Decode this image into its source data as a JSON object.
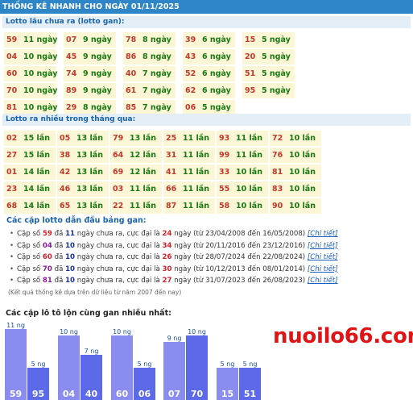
{
  "header": {
    "title": "THỐNG KÊ NHANH CHO NGÀY 01/11/2025"
  },
  "gan_section": {
    "title": "Lotto lâu chưa ra (lotto gan):",
    "columns": [
      [
        {
          "num": "59",
          "count": "11 ngày"
        },
        {
          "num": "04",
          "count": "10 ngày"
        },
        {
          "num": "60",
          "count": "10 ngày"
        },
        {
          "num": "70",
          "count": "10 ngày"
        },
        {
          "num": "81",
          "count": "10 ngày"
        }
      ],
      [
        {
          "num": "07",
          "count": "9 ngày"
        },
        {
          "num": "45",
          "count": "9 ngày"
        },
        {
          "num": "74",
          "count": "9 ngày"
        },
        {
          "num": "89",
          "count": "9 ngày"
        },
        {
          "num": "29",
          "count": "8 ngày"
        }
      ],
      [
        {
          "num": "78",
          "count": "8 ngày"
        },
        {
          "num": "86",
          "count": "8 ngày"
        },
        {
          "num": "40",
          "count": "7 ngày"
        },
        {
          "num": "61",
          "count": "7 ngày"
        },
        {
          "num": "85",
          "count": "7 ngày"
        }
      ],
      [
        {
          "num": "39",
          "count": "6 ngày"
        },
        {
          "num": "43",
          "count": "6 ngày"
        },
        {
          "num": "52",
          "count": "6 ngày"
        },
        {
          "num": "62",
          "count": "6 ngày"
        },
        {
          "num": "06",
          "count": "5 ngày"
        }
      ],
      [
        {
          "num": "15",
          "count": "5 ngày"
        },
        {
          "num": "20",
          "count": "5 ngày"
        },
        {
          "num": "51",
          "count": "5 ngày"
        },
        {
          "num": "95",
          "count": "5 ngày"
        }
      ]
    ]
  },
  "frequent_section": {
    "title": "Lotto ra nhiều trong tháng qua:",
    "columns": [
      [
        {
          "num": "02",
          "count": "15 lần"
        },
        {
          "num": "27",
          "count": "15 lần"
        },
        {
          "num": "01",
          "count": "14 lần"
        },
        {
          "num": "23",
          "count": "14 lần"
        },
        {
          "num": "68",
          "count": "14 lần"
        }
      ],
      [
        {
          "num": "05",
          "count": "13 lần"
        },
        {
          "num": "38",
          "count": "13 lần"
        },
        {
          "num": "42",
          "count": "13 lần"
        },
        {
          "num": "46",
          "count": "13 lần"
        },
        {
          "num": "65",
          "count": "13 lần"
        }
      ],
      [
        {
          "num": "79",
          "count": "13 lần"
        },
        {
          "num": "64",
          "count": "12 lần"
        },
        {
          "num": "69",
          "count": "12 lần"
        },
        {
          "num": "03",
          "count": "11 lần"
        },
        {
          "num": "22",
          "count": "11 lần"
        }
      ],
      [
        {
          "num": "25",
          "count": "11 lần"
        },
        {
          "num": "31",
          "count": "11 lần"
        },
        {
          "num": "41",
          "count": "11 lần"
        },
        {
          "num": "66",
          "count": "11 lần"
        },
        {
          "num": "87",
          "count": "11 lần"
        }
      ],
      [
        {
          "num": "93",
          "count": "11 lần"
        },
        {
          "num": "99",
          "count": "11 lần"
        },
        {
          "num": "33",
          "count": "10 lần"
        },
        {
          "num": "55",
          "count": "10 lần"
        },
        {
          "num": "58",
          "count": "10 lần"
        }
      ],
      [
        {
          "num": "72",
          "count": "10 lần"
        },
        {
          "num": "76",
          "count": "10 lần"
        },
        {
          "num": "81",
          "count": "10 lần"
        },
        {
          "num": "83",
          "count": "10 lần"
        },
        {
          "num": "90",
          "count": "10 lần"
        }
      ]
    ]
  },
  "pairs_section": {
    "title": "Các cặp lotto dẫn đầu bảng gan:",
    "items": [
      {
        "prefix": "Cặp số ",
        "pair": "59",
        "mid1": " đã ",
        "days": "11",
        "mid2": " ngày chưa ra, cực đại là ",
        "max": "24",
        "range": " ngày (từ 23/04/2008 đến 16/05/2008) ",
        "link": "[Chi tiết]",
        "pair_style": "red"
      },
      {
        "prefix": "Cặp số ",
        "pair": "04",
        "mid1": " đã ",
        "days": "10",
        "mid2": " ngày chưa ra, cực đại là ",
        "max": "34",
        "range": " ngày (từ 20/11/2016 đến 23/12/2016) ",
        "link": "[Chi tiết]",
        "pair_style": "pur"
      },
      {
        "prefix": "Cặp số ",
        "pair": "60",
        "mid1": " đã ",
        "days": "10",
        "mid2": " ngày chưa ra, cực đại là ",
        "max": "26",
        "range": " ngày (từ 28/07/2024 đến 22/08/2024) ",
        "link": "[Chi tiết]",
        "pair_style": "red"
      },
      {
        "prefix": "Cặp số ",
        "pair": "70",
        "mid1": " đã ",
        "days": "10",
        "mid2": " ngày chưa ra, cực đại là ",
        "max": "30",
        "range": " ngày (từ 10/12/2013 đến 08/01/2014) ",
        "link": "[Chi tiết]",
        "pair_style": "pur"
      },
      {
        "prefix": "Cặp số ",
        "pair": "81",
        "mid1": " đã ",
        "days": "10",
        "mid2": " ngày chưa ra, cực đại là ",
        "max": "27",
        "range": " ngày (từ 31/07/2023 đến 26/08/2023) ",
        "link": "[Chi tiết]",
        "pair_style": "pur"
      }
    ],
    "note": "(Kết quả thống kê dựa trên dữ liệu từ năm 2007 đến nay)"
  },
  "chart_section": {
    "title": "Các cặp lô tô lộn cùng gan nhiều nhất:"
  },
  "chart_data": {
    "type": "bar",
    "groups": [
      {
        "bars": [
          {
            "label": "59",
            "value": 11,
            "value_label": "11 ng"
          },
          {
            "label": "95",
            "value": 5,
            "value_label": "5 ng"
          }
        ]
      },
      {
        "bars": [
          {
            "label": "04",
            "value": 10,
            "value_label": "10 ng"
          },
          {
            "label": "40",
            "value": 7,
            "value_label": "7 ng"
          }
        ]
      },
      {
        "bars": [
          {
            "label": "60",
            "value": 10,
            "value_label": "10 ng"
          },
          {
            "label": "06",
            "value": 5,
            "value_label": "5 ng"
          }
        ]
      },
      {
        "bars": [
          {
            "label": "07",
            "value": 9,
            "value_label": "9 ng"
          },
          {
            "label": "70",
            "value": 10,
            "value_label": "10 ng"
          }
        ]
      },
      {
        "bars": [
          {
            "label": "15",
            "value": 5,
            "value_label": "5 ng"
          },
          {
            "label": "51",
            "value": 5,
            "value_label": "5 ng"
          }
        ]
      }
    ],
    "colors": {
      "first": "#8b8cf0",
      "second": "#5c69e8"
    }
  },
  "brand": {
    "text": "nuoilo66.com",
    "color": "#e01414"
  },
  "colors": {
    "header_bg": "#2e86c9",
    "cell_bg": "#fbf6d6",
    "num": "#c0392b",
    "count": "#1a7a12"
  }
}
